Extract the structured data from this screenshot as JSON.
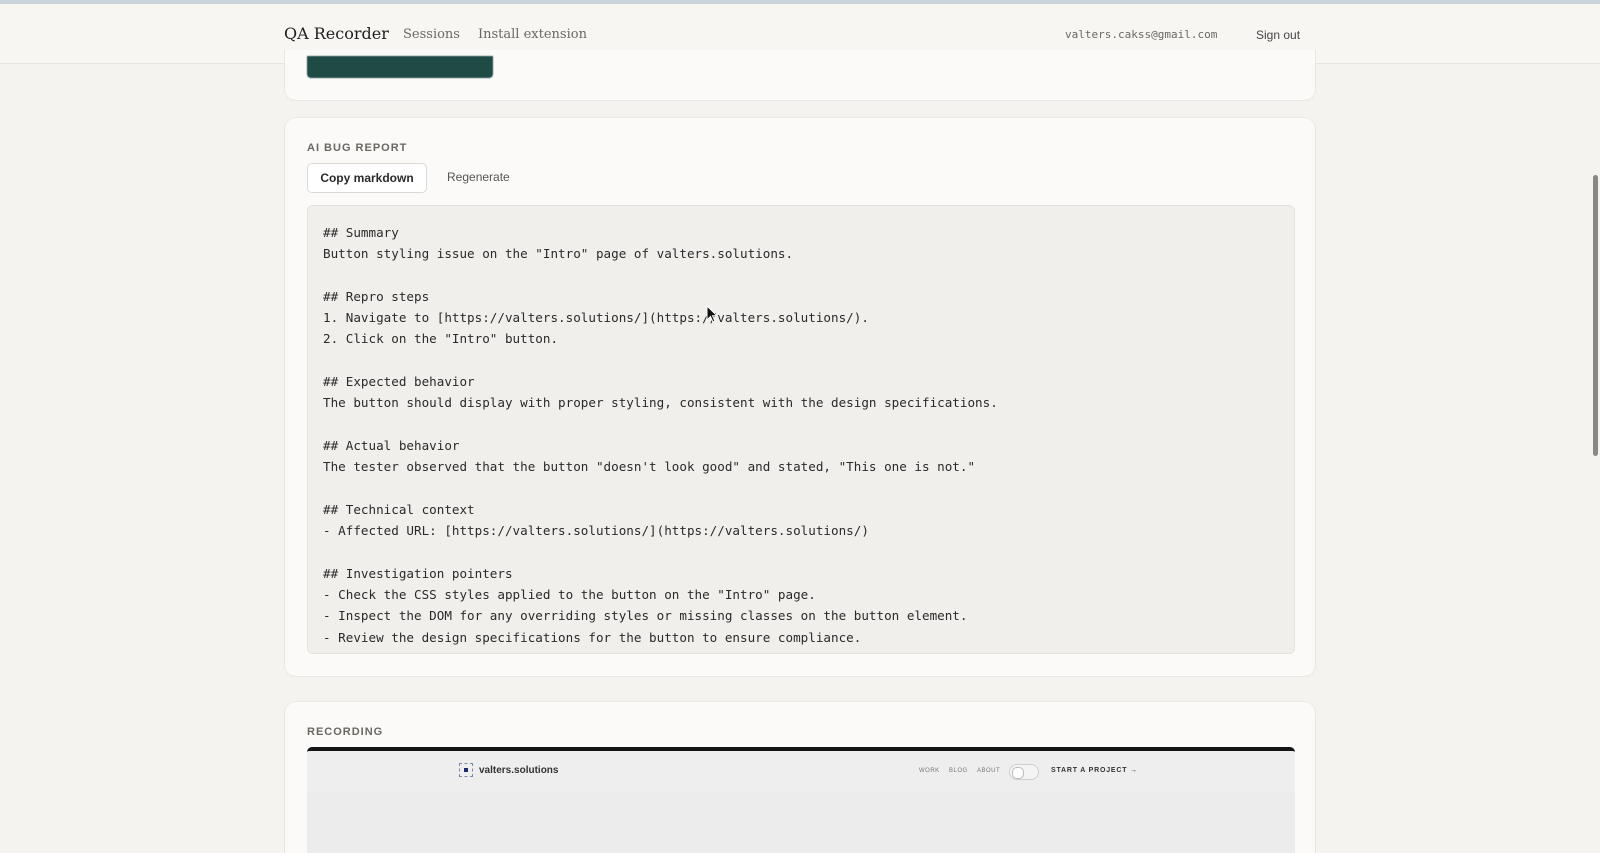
{
  "header": {
    "brand": "QA Recorder",
    "nav": [
      "Sessions",
      "Install extension"
    ],
    "email": "valters.cakss@gmail.com",
    "sign_out": "Sign out"
  },
  "report": {
    "section_label": "AI BUG REPORT",
    "copy_button": "Copy markdown",
    "regenerate_button": "Regenerate",
    "lines": [
      "## Summary",
      "Button styling issue on the \"Intro\" page of valters.solutions.",
      "",
      "## Repro steps",
      "1. Navigate to [https://valters.solutions/](https://valters.solutions/).",
      "2. Click on the \"Intro\" button.",
      "",
      "## Expected behavior",
      "The button should display with proper styling, consistent with the design specifications.",
      "",
      "## Actual behavior",
      "The tester observed that the button \"doesn't look good\" and stated, \"This one is not.\"",
      "",
      "## Technical context",
      "- Affected URL: [https://valters.solutions/](https://valters.solutions/)",
      "",
      "## Investigation pointers",
      "- Check the CSS styles applied to the button on the \"Intro\" page.",
      "- Inspect the DOM for any overriding styles or missing classes on the button element.",
      "- Review the design specifications for the button to ensure compliance."
    ]
  },
  "recording": {
    "section_label": "RECORDING",
    "site_logo": "valters.solutions",
    "site_nav": [
      "WORK",
      "BLOG",
      "ABOUT"
    ],
    "site_cta": "START A PROJECT →"
  },
  "colors": {
    "background": "#f5f3f0",
    "card": "#fbfaf8",
    "accent_button": "#1f4a45",
    "code_bg": "#f1efec"
  }
}
